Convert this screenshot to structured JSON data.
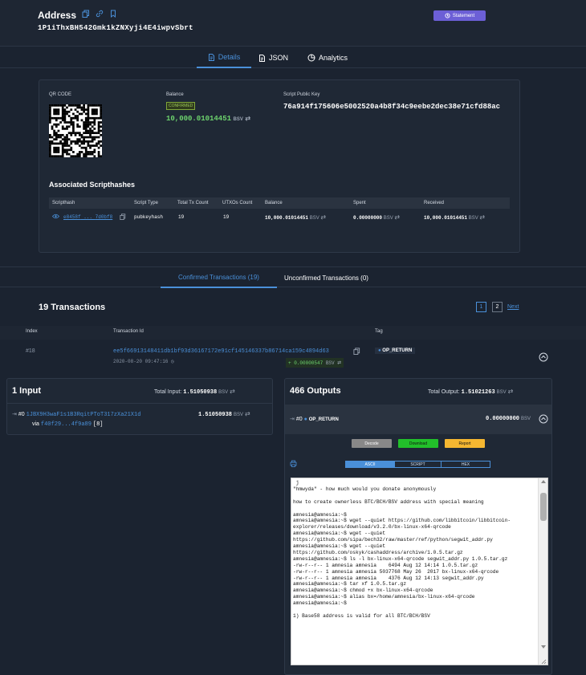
{
  "header": {
    "title": "Address",
    "address": "1P1iThxBH542Gmk1kZNXyji4E4iwpvSbrt",
    "statement_label": "Statement"
  },
  "tabs": [
    {
      "label": "Details"
    },
    {
      "label": "JSON"
    },
    {
      "label": "Analytics"
    }
  ],
  "details": {
    "qr_label": "QR CODE",
    "balance_label": "Balance",
    "status_badge": "CONFIRMED",
    "balance_value": "10,000.01014451",
    "unit": "BSV",
    "spk_label": "Script Public Key",
    "spk_value": "76a914f175606e5002520a4b8f34c9eebe2dec38e71cfd88ac",
    "assoc_title": "Associated Scripthashes",
    "columns": [
      "Scripthash",
      "Script Type",
      "Total Tx Count",
      "UTXOs Count",
      "Balance",
      "Spent",
      "Received"
    ],
    "row": {
      "scripthash_a": "e8458f",
      "scripthash_b": "7d0bf8",
      "script_type": "pubkeyhash",
      "total_tx": "19",
      "utxos": "19",
      "balance": "10,000.01014451",
      "spent": "0.00000000",
      "received": "10,000.01014451"
    }
  },
  "tx_tabs": {
    "confirmed": "Confirmed Transactions (19)",
    "unconfirmed": "Unconfirmed Transactions (0)"
  },
  "tx_list": {
    "count_title": "19 Transactions",
    "pages": [
      "1",
      "2"
    ],
    "next": "Next",
    "columns": [
      "Index",
      "Transaction Id",
      "Tag"
    ]
  },
  "tx": {
    "index": "#18",
    "txid": "ee5f66913148411db1bf93d36167172e91cf145146337b86714ca159c4894d63",
    "date": "2020-08-20 09:47:16",
    "amount": "+ 0.00000547",
    "tag": "OP_RETURN"
  },
  "inputs": {
    "title": "1 Input",
    "total_label": "Total Input:",
    "total_value": "1.51050938",
    "item_index": "#0",
    "item_address": "1JBX9H3waF1s1B3RqitPToT317zXa21X1d",
    "item_value": "1.51050938",
    "via_label": "via",
    "via_a": "f40f29",
    "via_b": "4f9a89",
    "via_index": "[8]"
  },
  "outputs": {
    "title": "466 Outputs",
    "total_label": "Total Output:",
    "total_value": "1.51021263",
    "item_index": "#0",
    "item_tag": "OP_RETURN",
    "item_value": "0.00000000",
    "btn_decode": "Decode",
    "btn_download": "Download",
    "btn_report": "Report",
    "seg_ascii": "ASCII",
    "seg_script": "SCRIPT",
    "seg_hex": "HEX",
    "terminal_lines": [
      " j",
      "\"hmwyda\" - how much would you donate anonymously",
      "",
      "how to create ownerless BTC/BCH/BSV address with special meaning",
      "",
      "amnesia@amnesia:~$",
      "amnesia@amnesia:~$ wget --quiet https://github.com/libbitcoin/libbitcoin-",
      "explorer/releases/download/v3.2.0/bx-linux-x64-qrcode",
      "amnesia@amnesia:~$ wget --quiet",
      "https://github.com/sipa/bech32/raw/master/ref/python/segwit_addr.py",
      "amnesia@amnesia:~$ wget --quiet",
      "https://github.com/oskyk/cashaddress/archive/1.0.5.tar.gz",
      "amnesia@amnesia:~$ ls -l bx-linux-x64-qrcode segwit_addr.py 1.0.5.tar.gz",
      "-rw-r--r-- 1 amnesia amnesia    6494 Aug 12 14:14 1.0.5.tar.gz",
      "-rw-r--r-- 1 amnesia amnesia 5037768 May 26  2017 bx-linux-x64-qrcode",
      "-rw-r--r-- 1 amnesia amnesia    4376 Aug 12 14:13 segwit_addr.py",
      "amnesia@amnesia:~$ tar xf 1.0.5.tar.gz",
      "amnesia@amnesia:~$ chmod +x bx-linux-x64-qrcode",
      "amnesia@amnesia:~$ alias bx=/home/amnesia/bx-linux-x64-qrcode",
      "amnesia@amnesia:~$",
      "",
      "1) Base58 address is valid for all BTC/BCH/BSV"
    ]
  },
  "colors": {
    "accent": "#4a90d9",
    "purple": "#6c5fd6",
    "green": "#6dd36d",
    "download": "#22c02a",
    "report": "#f5b731",
    "decode": "#888888"
  }
}
